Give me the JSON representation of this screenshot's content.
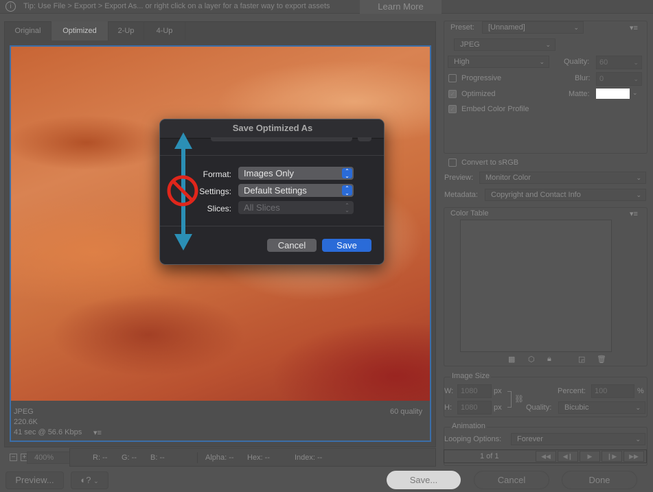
{
  "tip": {
    "text": "Tip: Use File > Export > Export As...  or right click on a layer for a faster way to export assets",
    "learn_more": "Learn More"
  },
  "tabs": [
    "Original",
    "Optimized",
    "2-Up",
    "4-Up"
  ],
  "active_tab": "Optimized",
  "image_info": {
    "format": "JPEG",
    "size": "220.6K",
    "time": "41 sec @ 56.6 Kbps",
    "quality": "60 quality"
  },
  "zoom": {
    "value": "400%"
  },
  "readout": {
    "r": "R: --",
    "g": "G: --",
    "b": "B: --",
    "alpha": "Alpha: --",
    "hex": "Hex: --",
    "index": "Index: --"
  },
  "bottom": {
    "preview": "Preview...",
    "save": "Save...",
    "cancel": "Cancel",
    "done": "Done"
  },
  "settings": {
    "preset_label": "Preset:",
    "preset": "[Unnamed]",
    "format": "JPEG",
    "compression": "High",
    "quality_label": "Quality:",
    "quality": "60",
    "progressive": "Progressive",
    "progressive_checked": false,
    "blur_label": "Blur:",
    "blur": "0",
    "optimized": "Optimized",
    "optimized_checked": true,
    "matte_label": "Matte:",
    "matte_color": "#ffffff",
    "embed": "Embed Color Profile",
    "embed_checked": true,
    "srgb": "Convert to sRGB",
    "srgb_checked": false,
    "preview_label": "Preview:",
    "preview": "Monitor Color",
    "metadata_label": "Metadata:",
    "metadata": "Copyright and Contact Info"
  },
  "color_table": {
    "title": "Color Table"
  },
  "image_size": {
    "title": "Image Size",
    "w_label": "W:",
    "w": "1080",
    "h_label": "H:",
    "h": "1080",
    "unit": "px",
    "percent_label": "Percent:",
    "percent": "100",
    "percent_unit": "%",
    "quality_label": "Quality:",
    "quality": "Bicubic"
  },
  "animation": {
    "title": "Animation",
    "looping_label": "Looping Options:",
    "looping": "Forever",
    "frame": "1 of 1"
  },
  "dialog": {
    "title": "Save Optimized As",
    "format_label": "Format:",
    "format": "Images Only",
    "settings_label": "Settings:",
    "settings": "Default Settings",
    "slices_label": "Slices:",
    "slices": "All Slices",
    "cancel": "Cancel",
    "save": "Save"
  },
  "colors": {
    "accent": "#2a6bd8",
    "cursor_arrow": "#2b8fb5",
    "no_symbol": "#e0261b"
  }
}
